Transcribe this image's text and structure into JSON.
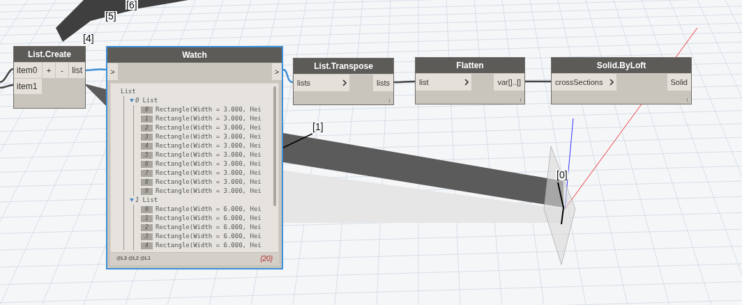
{
  "viewport": {
    "labels": [
      "[6]",
      "[5]",
      "[4]",
      "[1]",
      "[0]"
    ]
  },
  "nodes": [
    {
      "kind": "list_create",
      "title": "List.Create",
      "selected": false,
      "inputs": [
        "item0",
        "item1"
      ],
      "buttons": [
        "+",
        "-"
      ],
      "outputs": [
        "list"
      ]
    },
    {
      "kind": "watch",
      "title": "Watch",
      "selected": true,
      "input_port": ">",
      "output_port": ">",
      "tree": {
        "label": "List",
        "children": [
          {
            "index": "0",
            "label": "List",
            "expanded": true,
            "items": [
              {
                "index": "0",
                "text": "Rectangle(Width = 3.000, Hei"
              },
              {
                "index": "1",
                "text": "Rectangle(Width = 3.000, Hei"
              },
              {
                "index": "2",
                "text": "Rectangle(Width = 3.000, Hei"
              },
              {
                "index": "3",
                "text": "Rectangle(Width = 3.000, Hei"
              },
              {
                "index": "4",
                "text": "Rectangle(Width = 3.000, Hei"
              },
              {
                "index": "5",
                "text": "Rectangle(Width = 3.000, Hei"
              },
              {
                "index": "6",
                "text": "Rectangle(Width = 3.000, Hei"
              },
              {
                "index": "7",
                "text": "Rectangle(Width = 3.000, Hei"
              },
              {
                "index": "8",
                "text": "Rectangle(Width = 3.000, Hei"
              },
              {
                "index": "9",
                "text": "Rectangle(Width = 3.000, Hei"
              }
            ]
          },
          {
            "index": "1",
            "label": "List",
            "expanded": true,
            "items": [
              {
                "index": "0",
                "text": "Rectangle(Width = 6.000, Hei"
              },
              {
                "index": "1",
                "text": "Rectangle(Width = 6.000, Hei"
              },
              {
                "index": "2",
                "text": "Rectangle(Width = 6.000, Hei"
              },
              {
                "index": "3",
                "text": "Rectangle(Width = 6.000, Hei"
              },
              {
                "index": "4",
                "text": "Rectangle(Width = 6.000, Hei"
              }
            ]
          }
        ]
      },
      "levels": [
        "@L3",
        "@L2",
        "@L1"
      ],
      "count": "{20}"
    },
    {
      "kind": "function",
      "title": "List.Transpose",
      "selected": false,
      "inputs": [
        "lists"
      ],
      "outputs": [
        "lists"
      ],
      "lacing": "l"
    },
    {
      "kind": "function",
      "title": "Flatten",
      "selected": false,
      "inputs": [
        "list"
      ],
      "outputs": [
        "var[]..[]"
      ],
      "lacing": "l"
    },
    {
      "kind": "function",
      "title": "Solid.ByLoft",
      "selected": false,
      "inputs": [
        "crossSections"
      ],
      "outputs": [
        "Solid"
      ],
      "lacing": "l"
    }
  ]
}
